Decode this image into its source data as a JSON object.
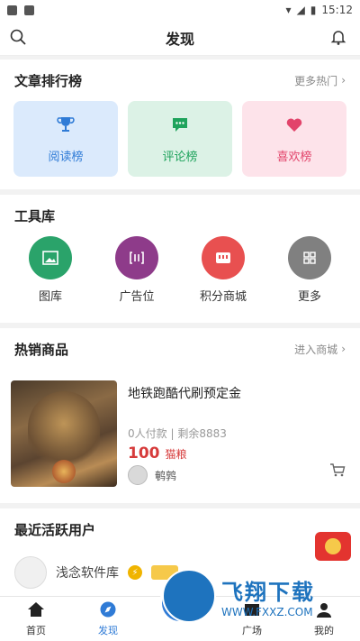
{
  "statusbar": {
    "time": "15:12"
  },
  "header": {
    "title": "发现"
  },
  "rank": {
    "title": "文章排行榜",
    "more": "更多热门",
    "cards": [
      {
        "label": "阅读榜",
        "icon": "trophy-icon",
        "color": "#2f7bd6"
      },
      {
        "label": "评论榜",
        "icon": "chat-icon",
        "color": "#1fa35c"
      },
      {
        "label": "喜欢榜",
        "icon": "heart-icon",
        "color": "#e2446b"
      }
    ]
  },
  "tools": {
    "title": "工具库",
    "items": [
      {
        "label": "图库",
        "color": "#2aa36a",
        "icon": "image-icon"
      },
      {
        "label": "广告位",
        "color": "#8e3b8a",
        "icon": "ad-icon"
      },
      {
        "label": "积分商城",
        "color": "#e85050",
        "icon": "store-icon"
      },
      {
        "label": "更多",
        "color": "#808080",
        "icon": "grid-icon"
      }
    ]
  },
  "hot": {
    "title": "热销商品",
    "more": "进入商城",
    "product": {
      "title": "地铁跑酷代刷预定金",
      "sold": "0人付款",
      "remaining": "剩余8883",
      "price": "100",
      "unit": "猫粮",
      "seller": "鹌鹑"
    }
  },
  "users": {
    "title": "最近活跃用户",
    "items": [
      {
        "name": "浅念软件库"
      }
    ]
  },
  "nav": {
    "items": [
      {
        "label": "首页"
      },
      {
        "label": "发现"
      },
      {
        "label": ""
      },
      {
        "label": "广场"
      },
      {
        "label": "我的"
      }
    ]
  },
  "watermark": {
    "title": "飞翔下载",
    "url": "WWW.FXXZ.COM"
  }
}
